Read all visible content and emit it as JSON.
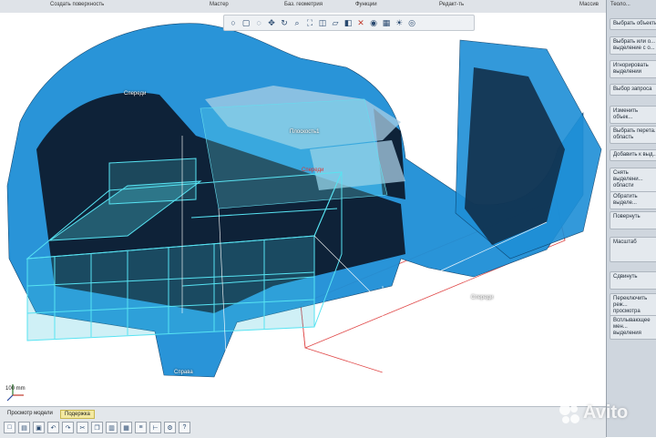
{
  "ribbon": {
    "groups": [
      "Создать поверхность",
      "Мастер",
      "Баз. геометрия",
      "Функции",
      "Редакт-ть",
      "Массив",
      "Теоло..."
    ]
  },
  "viewport": {
    "labels": {
      "front_top": "Спереди",
      "plane": "Плоскость1",
      "front_red": "Спереди",
      "front_bottom": "Спереди",
      "right": "Справа"
    },
    "scale": "100 mm"
  },
  "right_panel": {
    "title": "Теоло...",
    "buttons": [
      "Выбрать объекты",
      "Выбрать или о...\nвыделение с о...",
      "Игнорировать\nвыделении",
      "Выбор запроса",
      "Изменить объек...",
      "Выбрать перета...\nобласть",
      "Добавить к выд...",
      "Снять выделени...\nобласти",
      "Обратить выделе...",
      "Повернуть",
      "Масштаб",
      "Сдвинуть",
      "Переключить реж...\nпросмотра",
      "Всплывающее мен...\nвыделения"
    ]
  },
  "bottom": {
    "tabs": [
      "Просмотр модели",
      "Подержка"
    ]
  },
  "watermark": {
    "text": "Avito"
  },
  "colors": {
    "scan": "#1e8fd6",
    "cad": "#57e3f2",
    "red_guide": "#e04848"
  }
}
